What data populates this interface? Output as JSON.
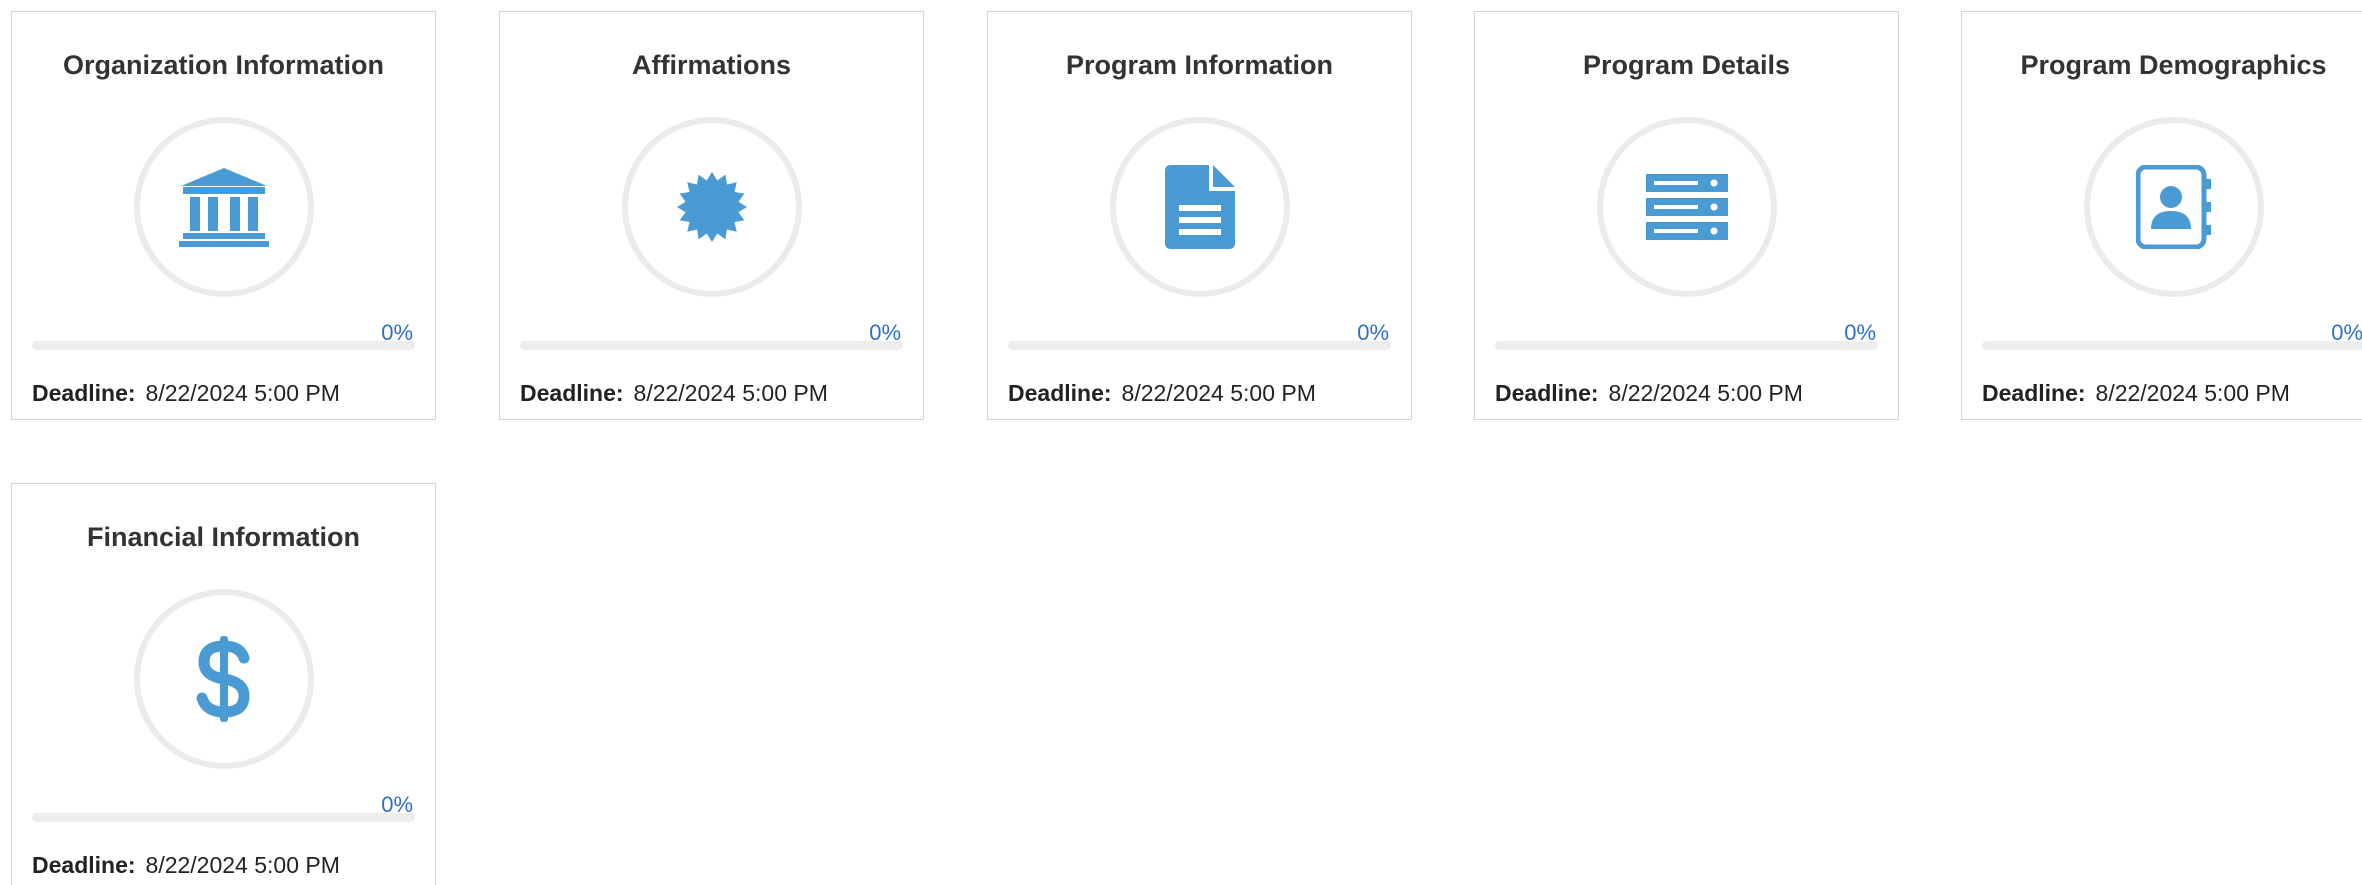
{
  "colors": {
    "accent": "#4a9ad4",
    "percent_text": "#2f6fc8",
    "border": "#d4d4d4",
    "circle": "#ebebeb"
  },
  "cards": [
    {
      "title": "Organization Information",
      "icon": "bank-icon",
      "percent_label": "0%",
      "progress": 0,
      "deadline_label": "Deadline:",
      "deadline_value": "8/22/2024 5:00 PM"
    },
    {
      "title": "Affirmations",
      "icon": "badge-certificate-icon",
      "percent_label": "0%",
      "progress": 0,
      "deadline_label": "Deadline:",
      "deadline_value": "8/22/2024 5:00 PM"
    },
    {
      "title": "Program Information",
      "icon": "document-icon",
      "percent_label": "0%",
      "progress": 0,
      "deadline_label": "Deadline:",
      "deadline_value": "8/22/2024 5:00 PM"
    },
    {
      "title": "Program Details",
      "icon": "server-list-icon",
      "percent_label": "0%",
      "progress": 0,
      "deadline_label": "Deadline:",
      "deadline_value": "8/22/2024 5:00 PM"
    },
    {
      "title": "Program Demographics",
      "icon": "address-book-icon",
      "percent_label": "0%",
      "progress": 0,
      "deadline_label": "Deadline:",
      "deadline_value": "8/22/2024 5:00 PM"
    },
    {
      "title": "Financial Information",
      "icon": "dollar-icon",
      "percent_label": "0%",
      "progress": 0,
      "deadline_label": "Deadline:",
      "deadline_value": "8/22/2024 5:00 PM"
    }
  ]
}
